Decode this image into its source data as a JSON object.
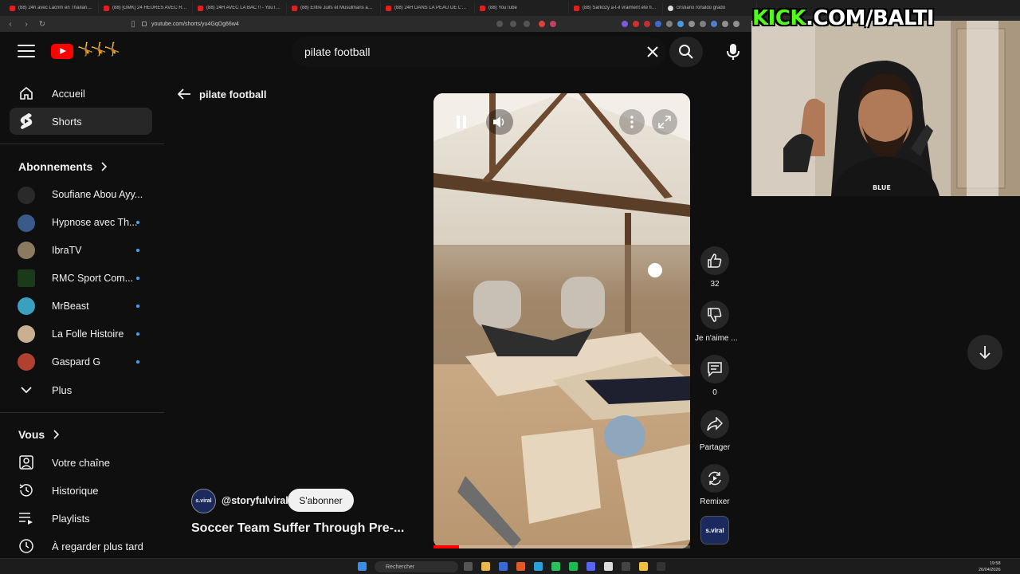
{
  "browser": {
    "tabs": [
      {
        "title": "(88) 24h avec Lacrim en Thaïlande !!"
      },
      {
        "title": "(88) [GMK] 24 HEURES AVEC RAGNAR"
      },
      {
        "title": "(88) 24H AVEC LA BAC !! - YouTube"
      },
      {
        "title": "(88) Entre Juifs et Musulmans au Ma"
      },
      {
        "title": "(88) 24H DANS LA PEAU DE L'ADO !!"
      },
      {
        "title": "(88) YouTube"
      },
      {
        "title": "(88) Sarkozy a-t-il vraiment été finan"
      },
      {
        "title": "cristiano ronaldo grado"
      }
    ],
    "url": "youtube.com/shorts/yu4GqOg66w4"
  },
  "header": {
    "search_query": "pilate football"
  },
  "sidebar": {
    "main": [
      {
        "label": "Accueil",
        "icon": "home-icon"
      },
      {
        "label": "Shorts",
        "icon": "shorts-icon",
        "active": true
      }
    ],
    "subscriptions_title": "Abonnements",
    "subscriptions": [
      {
        "label": "Soufiane Abou Ayy...",
        "new": false,
        "color": "#2a2a2a"
      },
      {
        "label": "Hypnose avec Th...",
        "new": true,
        "color": "#3a5a8a"
      },
      {
        "label": "IbraTV",
        "new": true,
        "color": "#8a7a60"
      },
      {
        "label": "RMC Sport Com...",
        "new": true,
        "color": "#1a3a1a"
      },
      {
        "label": "MrBeast",
        "new": true,
        "color": "#3aa0c0"
      },
      {
        "label": "La Folle Histoire",
        "new": true,
        "color": "#c8b090"
      },
      {
        "label": "Gaspard G",
        "new": true,
        "color": "#b04030"
      }
    ],
    "more_label": "Plus",
    "you_title": "Vous",
    "you_items": [
      {
        "label": "Votre chaîne",
        "icon": "channel-icon"
      },
      {
        "label": "Historique",
        "icon": "history-icon"
      },
      {
        "label": "Playlists",
        "icon": "playlist-icon"
      },
      {
        "label": "À regarder plus tard",
        "icon": "watch-later-icon"
      }
    ]
  },
  "main": {
    "back_label": "pilate football",
    "channel_avatar_text": "s.viral",
    "channel_handle": "@storyfulviral",
    "subscribe_label": "S'abonner",
    "video_title": "Soccer Team Suffer Through Pre-...",
    "video_progress": 0.1
  },
  "actions": {
    "like_count": "32",
    "dislike_label": "Je n'aime ...",
    "comment_count": "0",
    "share_label": "Partager",
    "remix_label": "Remixer",
    "channel_thumb_text": "s.viral"
  },
  "overlay": {
    "kick_green": "KICK",
    "kick_rest": ".COM/BALTI"
  },
  "taskbar": {
    "search_placeholder": "Rechercher",
    "time": "19:58",
    "date": "26/04/2026"
  },
  "colors": {
    "accent_red": "#ff0000",
    "kick_green": "#53fc18",
    "new_dot": "#3ea6ff"
  }
}
